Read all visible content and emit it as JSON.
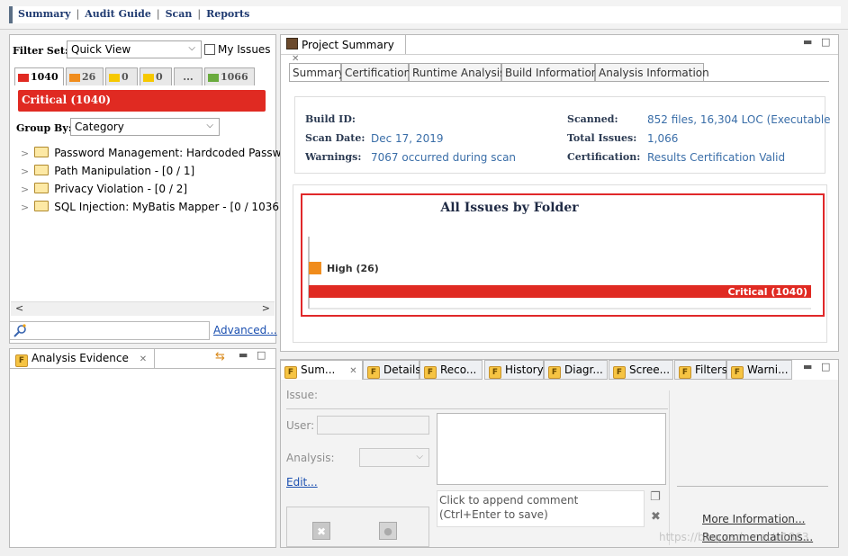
{
  "topnav": {
    "links": [
      "Summary",
      "Audit Guide",
      "Scan",
      "Reports"
    ]
  },
  "filter": {
    "label": "Filter Set:",
    "value": "Quick View",
    "my_issues": "My Issues"
  },
  "severity_tabs": [
    {
      "count": "1040",
      "color": "#e02a22"
    },
    {
      "count": "26",
      "color": "#f08c1c"
    },
    {
      "count": "0",
      "color": "#f6c800"
    },
    {
      "count": "0",
      "color": "#f6c800"
    },
    {
      "count": "...",
      "color": ""
    },
    {
      "count": "1066",
      "color": "#6aab3e"
    }
  ],
  "critical_label": "Critical (1040)",
  "group_by": {
    "label": "Group By:",
    "value": "Category"
  },
  "tree": [
    "Password Management: Hardcoded Passw",
    "Path Manipulation - [0 / 1]",
    "Privacy Violation - [0 / 2]",
    "SQL Injection: MyBatis Mapper - [0 / 1036]"
  ],
  "search": {
    "icon": "search-icon",
    "advanced": "Advanced..."
  },
  "evidence_tab": "Analysis Evidence",
  "project": {
    "tab": "Project Summary",
    "subtabs": [
      "Summary",
      "Certification",
      "Runtime Analysis",
      "Build Information",
      "Analysis Information"
    ],
    "build_id_label": "Build ID:",
    "scan_date_label": "Scan Date:",
    "scan_date": "Dec 17, 2019",
    "warnings_label": "Warnings:",
    "warnings": "7067 occurred during scan",
    "scanned_label": "Scanned:",
    "scanned": "852 files, 16,304 LOC (Executable",
    "total_label": "Total Issues:",
    "total": "1,066",
    "cert_label": "Certification:",
    "cert": "Results Certification Valid"
  },
  "chart_data": {
    "type": "bar",
    "title": "All Issues by Folder",
    "orientation": "horizontal",
    "categories": [
      "High",
      "Critical"
    ],
    "values": [
      26,
      1040
    ],
    "labels": [
      "High (26)",
      "Critical (1040)"
    ],
    "colors": [
      "#f08c1c",
      "#e02a22"
    ],
    "xlim": [
      0,
      1040
    ]
  },
  "issue_tabs": [
    "Sum...",
    "Details",
    "Reco...",
    "History",
    "Diagr...",
    "Scree...",
    "Filters",
    "Warni..."
  ],
  "issue": {
    "issue_label": "Issue:",
    "user_label": "User:",
    "analysis_label": "Analysis:",
    "edit": "Edit...",
    "comment_hint": "Click to append comment (Ctrl+Enter to save)",
    "more_info": "More Information...",
    "recommendations": "Recommendations..."
  },
  "watermark": "https://blog.csdn.net/u1863"
}
